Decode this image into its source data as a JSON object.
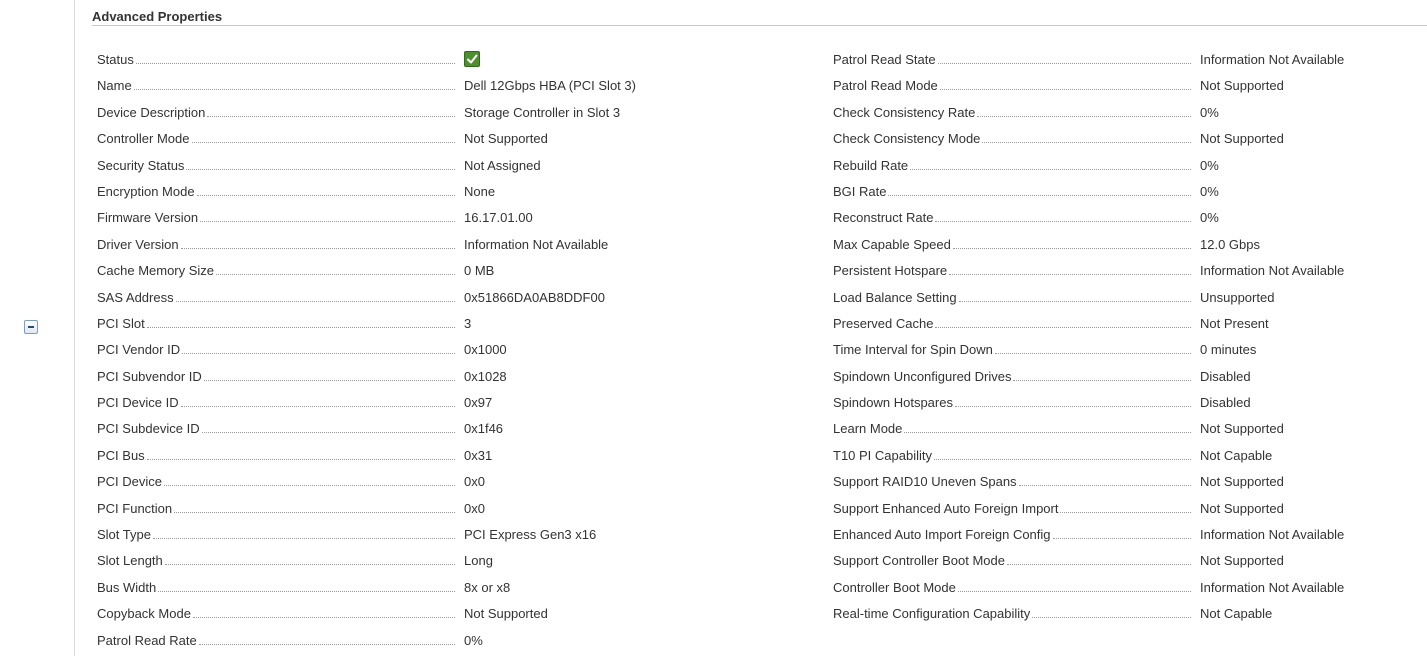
{
  "section": {
    "title": "Advanced Properties"
  },
  "status_icon": "check-ok-icon",
  "colors": {
    "status_ok": "#4f8f2f",
    "text": "#333333"
  },
  "left_properties": [
    {
      "label": "Status",
      "value": ""
    },
    {
      "label": "Name",
      "value": "Dell 12Gbps HBA (PCI Slot 3)"
    },
    {
      "label": "Device Description",
      "value": "Storage Controller in Slot 3"
    },
    {
      "label": "Controller Mode",
      "value": "Not Supported"
    },
    {
      "label": "Security Status",
      "value": "Not Assigned"
    },
    {
      "label": "Encryption Mode",
      "value": "None"
    },
    {
      "label": "Firmware Version",
      "value": "16.17.01.00"
    },
    {
      "label": "Driver Version",
      "value": "Information Not Available"
    },
    {
      "label": "Cache Memory Size",
      "value": "0 MB"
    },
    {
      "label": "SAS Address",
      "value": "0x51866DA0AB8DDF00"
    },
    {
      "label": "PCI Slot",
      "value": "3"
    },
    {
      "label": "PCI Vendor ID",
      "value": "0x1000"
    },
    {
      "label": "PCI Subvendor ID",
      "value": "0x1028"
    },
    {
      "label": "PCI Device ID",
      "value": "0x97"
    },
    {
      "label": "PCI Subdevice ID",
      "value": "0x1f46"
    },
    {
      "label": "PCI Bus",
      "value": "0x31"
    },
    {
      "label": "PCI Device",
      "value": "0x0"
    },
    {
      "label": "PCI Function",
      "value": "0x0"
    },
    {
      "label": "Slot Type",
      "value": "PCI Express Gen3 x16"
    },
    {
      "label": "Slot Length",
      "value": "Long"
    },
    {
      "label": "Bus Width",
      "value": "8x or x8"
    },
    {
      "label": "Copyback Mode",
      "value": "Not Supported"
    },
    {
      "label": "Patrol Read Rate",
      "value": "0%"
    }
  ],
  "right_properties": [
    {
      "label": "Patrol Read State",
      "value": "Information Not Available"
    },
    {
      "label": "Patrol Read Mode",
      "value": "Not Supported"
    },
    {
      "label": "Check Consistency Rate",
      "value": "0%"
    },
    {
      "label": "Check Consistency Mode",
      "value": "Not Supported"
    },
    {
      "label": "Rebuild Rate",
      "value": "0%"
    },
    {
      "label": "BGI Rate",
      "value": "0%"
    },
    {
      "label": "Reconstruct Rate",
      "value": "0%"
    },
    {
      "label": "Max Capable Speed",
      "value": "12.0 Gbps"
    },
    {
      "label": "Persistent Hotspare",
      "value": "Information Not Available"
    },
    {
      "label": "Load Balance Setting",
      "value": "Unsupported"
    },
    {
      "label": "Preserved Cache",
      "value": "Not Present"
    },
    {
      "label": "Time Interval for Spin Down",
      "value": "0 minutes"
    },
    {
      "label": "Spindown Unconfigured Drives",
      "value": "Disabled"
    },
    {
      "label": "Spindown Hotspares",
      "value": "Disabled"
    },
    {
      "label": "Learn Mode",
      "value": "Not Supported"
    },
    {
      "label": "T10 PI Capability",
      "value": "Not Capable"
    },
    {
      "label": "Support RAID10 Uneven Spans",
      "value": "Not Supported"
    },
    {
      "label": "Support Enhanced Auto Foreign Import",
      "value": "Not Supported"
    },
    {
      "label": "Enhanced Auto Import Foreign Config",
      "value": "Information Not Available"
    },
    {
      "label": "Support Controller Boot Mode",
      "value": "Not Supported"
    },
    {
      "label": "Controller Boot Mode",
      "value": "Information Not Available"
    },
    {
      "label": "Real-time Configuration Capability",
      "value": "Not Capable"
    }
  ]
}
